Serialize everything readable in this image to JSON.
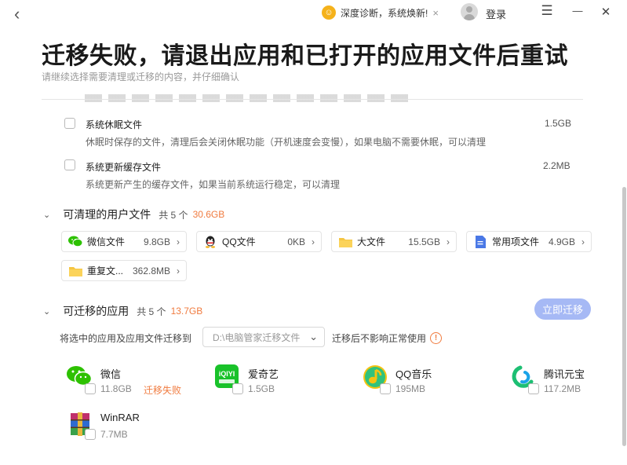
{
  "topbar": {
    "back_glyph": "‹",
    "promo_text": "深度诊断，系统焕新!",
    "promo_close": "×",
    "login_label": "登录",
    "menu_glyph": "☰",
    "minimize_glyph": "—",
    "close_glyph": "✕"
  },
  "header": {
    "title": "迁移失败，请退出应用和已打开的应用文件后重试",
    "subtitle": "请继续选择需要清理或迁移的内容，并仔细确认"
  },
  "system_items": [
    {
      "name": "系统休眠文件",
      "desc": "休眠时保存的文件，清理后会关闭休眠功能（开机速度会变慢），如果电脑不需要休眠，可以清理",
      "size": "1.5GB"
    },
    {
      "name": "系统更新缓存文件",
      "desc": "系统更新产生的缓存文件，如果当前系统运行稳定，可以清理",
      "size": "2.2MB"
    }
  ],
  "user_files": {
    "chevron": "⌄",
    "title": "可清理的用户文件",
    "count": "共 5 个",
    "size": "30.6GB",
    "cards": [
      {
        "icon": "wechat-icon",
        "name": "微信文件",
        "size": "9.8GB"
      },
      {
        "icon": "qq-icon",
        "name": "QQ文件",
        "size": "0KB"
      },
      {
        "icon": "folder-icon",
        "name": "大文件",
        "size": "15.5GB"
      },
      {
        "icon": "document-icon",
        "name": "常用项文件",
        "size": "4.9GB"
      },
      {
        "icon": "folder-icon",
        "name": "重复文...",
        "size": "362.8MB"
      }
    ],
    "arrow": "›"
  },
  "apps_section": {
    "chevron": "⌄",
    "title": "可迁移的应用",
    "count": "共 5 个",
    "size": "13.7GB",
    "migrate_button": "立即迁移",
    "dest_label": "将选中的应用及应用文件迁移到",
    "dest_value": "D:\\电脑管家迁移文件",
    "dest_chevron": "⌄",
    "dest_note": "迁移后不影响正常使用",
    "warn_glyph": "!",
    "apps": [
      {
        "icon": "wechat-icon",
        "name": "微信",
        "size": "11.8GB",
        "status": "迁移失败"
      },
      {
        "icon": "iqiyi-icon",
        "name": "爱奇艺",
        "size": "1.5GB",
        "status": ""
      },
      {
        "icon": "qqmusic-icon",
        "name": "QQ音乐",
        "size": "195MB",
        "status": ""
      },
      {
        "icon": "yuanbao-icon",
        "name": "腾讯元宝",
        "size": "117.2MB",
        "status": ""
      },
      {
        "icon": "winrar-icon",
        "name": "WinRAR",
        "size": "7.7MB",
        "status": ""
      }
    ],
    "iqiyi_logo_text": "iQIYI"
  },
  "colors": {
    "accent_orange": "#f07b3f",
    "button_blue": "#a6b9f5",
    "wechat_green": "#2dc100",
    "qq_music_yellow": "#f5c211"
  }
}
